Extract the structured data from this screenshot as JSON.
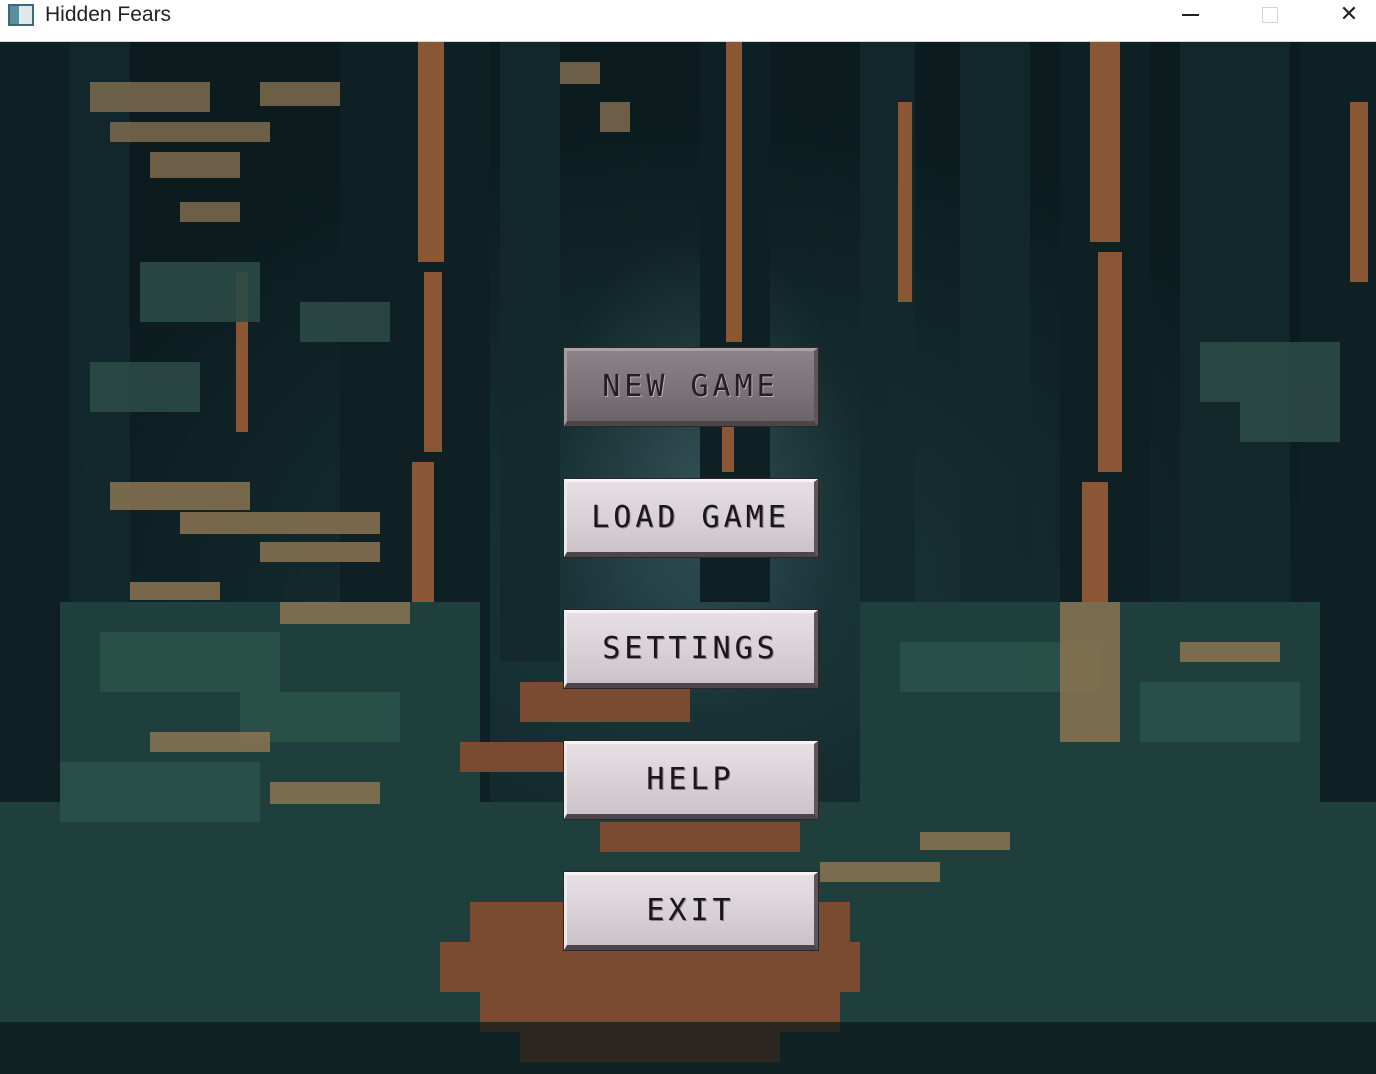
{
  "window": {
    "title": "Hidden Fears",
    "minimize_glyph": "—",
    "close_glyph": "✕"
  },
  "menu": {
    "new_game": "NEW GAME",
    "load_game": "LOAD GAME",
    "settings": "SETTINGS",
    "help": "HELP",
    "exit": "EXIT"
  },
  "colors": {
    "button_face": "#d7cfd4",
    "button_hover_face": "#7a7277",
    "forest_dark": "#0b1b1e",
    "forest_teal": "#1d3a3e",
    "bark_orange": "#8a5636"
  },
  "icons": {
    "app": "app-window-icon",
    "minimize": "minimize-icon",
    "maximize": "maximize-icon",
    "close": "close-icon"
  }
}
